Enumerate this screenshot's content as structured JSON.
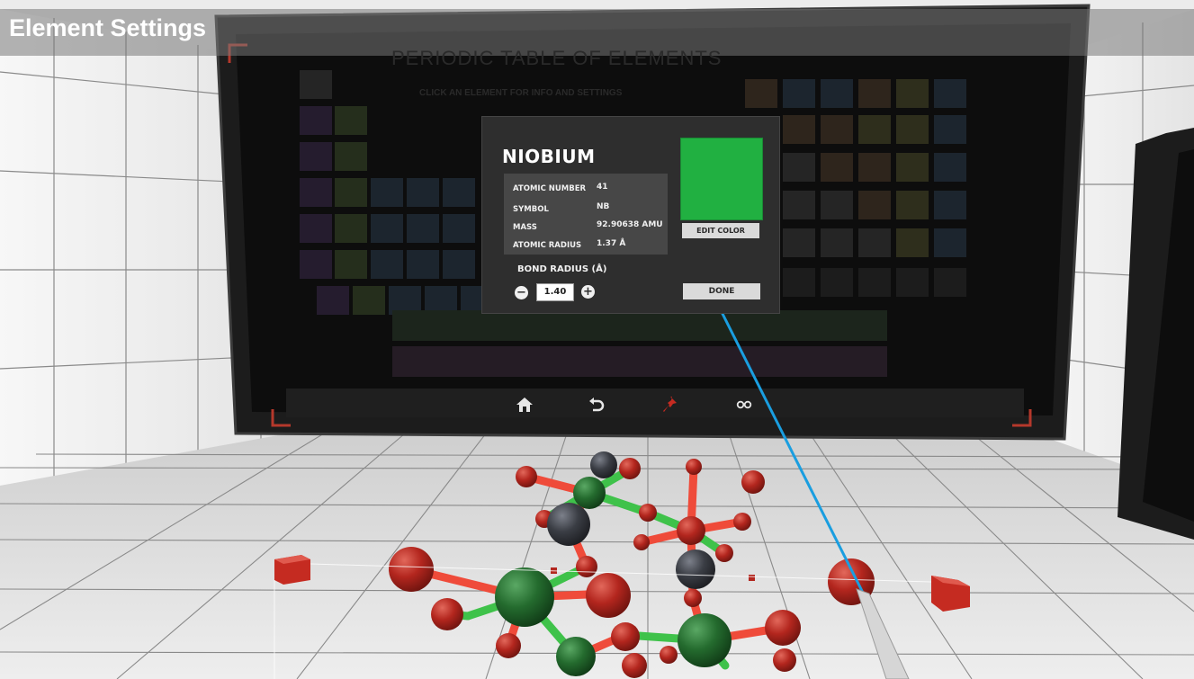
{
  "window": {
    "title": "Element Settings"
  },
  "periodic_table": {
    "title": "PERIODIC TABLE OF ELEMENTS",
    "subtitle": "CLICK AN ELEMENT FOR INFO AND SETTINGS"
  },
  "element": {
    "name": "NIOBIUM",
    "color": "#21b041",
    "rows": [
      {
        "label": "ATOMIC NUMBER",
        "value": "41"
      },
      {
        "label": "SYMBOL",
        "value": "NB"
      },
      {
        "label": "MASS",
        "value": "92.90638 AMU"
      },
      {
        "label": "ATOMIC RADIUS",
        "value": "1.37 Å"
      }
    ],
    "edit_color_label": "EDIT COLOR",
    "bond_radius_label": "BOND RADIUS (Å)",
    "bond_radius_value": "1.40",
    "done_label": "DONE"
  },
  "toolbar": {
    "home_icon": "home-icon",
    "undo_icon": "undo-icon",
    "pin_icon": "pin-icon",
    "glasses_icon": "glasses-icon"
  },
  "colors": {
    "accent_green": "#21b041",
    "pointer_blue": "#1a9ee0",
    "atom_red": "#b3261e",
    "atom_green": "#246b2e",
    "atom_gray": "#3a3d44",
    "bond_red": "#ef4b3a",
    "bond_green": "#3fc24a"
  }
}
